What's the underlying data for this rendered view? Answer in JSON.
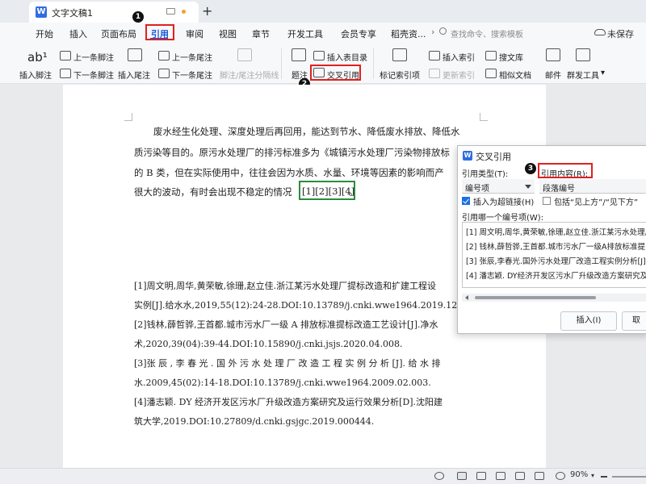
{
  "titlebar": {
    "doc_icon": "W",
    "doc_title": "文字文稿1",
    "add_tab": "+"
  },
  "left_glyph": "⟲",
  "menu": {
    "items": [
      "开始",
      "插入",
      "页面布局",
      "引用",
      "审阅",
      "视图",
      "章节",
      "开发工具",
      "会员专享",
      "稻壳资..."
    ],
    "active": "引用",
    "more": "›",
    "search_placeholder": "查找命令、搜索模板",
    "unsaved": "未保存"
  },
  "ribbon": {
    "insert_footnote": "插入脚注",
    "prev_footnote": "上一条脚注",
    "next_footnote": "下一条脚注",
    "insert_endnote": "插入尾注",
    "prev_endnote": "上一条尾注",
    "next_endnote": "下一条尾注",
    "footnote_separator": "脚注/尾注分隔线",
    "caption": "题注",
    "insert_toc": "插入表目录",
    "cross_reference": "交叉引用",
    "mark_index": "标记索引项",
    "insert_index": "插入索引",
    "update_index": "更新索引",
    "search_library": "搜文库",
    "similar_docs": "相似文档",
    "mail": "邮件",
    "mass_tools": "群发工具"
  },
  "steps": {
    "one": "1",
    "two": "2",
    "three": "3"
  },
  "document": {
    "paragraph_lines": [
      "废水经生化处理、深度处理后再回用，能达到节水、降低废水排放、降低水",
      "质污染等目的。原污水处理厂的排污标准多为《城镇污水处理厂污染物排放标",
      "的 B 类，但在实际使用中，往往会因为水质、水量、环境等因素的影响而产",
      "很大的波动，有时会出现不稳定的情况"
    ],
    "citation_marks": "[1][2][3][4]",
    "citation_tail": "。",
    "references": [
      "[1]周文明,周华,黄荣敏,徐珊,赵立佳.浙江某污水处理厂提标改造和扩建工程设",
      "实例[J].给水水,2019,55(12):24-28.DOI:10.13789/j.cnki.wwe1964.2019.12.00",
      "[2]钱林,薛哲骅,王首都.城市污水厂一级 A 排放标准提标改造工艺设计[J].净水",
      "术,2020,39(04):39-44.DOI:10.15890/j.cnki.jsjs.2020.04.008.",
      "[3]张 辰 , 李 春 光 . 国 外 污 水 处 理 厂 改 造 工 程 实 例 分 析 [J]. 给 水 排",
      "水.2009,45(02):14-18.DOI:10.13789/j.cnki.wwe1964.2009.02.003.",
      "[4]潘志颖. DY 经济开发区污水厂升级改造方案研究及运行效果分析[D].沈阳建",
      "筑大学,2019.DOI:10.27809/d.cnki.gsjgc.2019.000444."
    ]
  },
  "dialog": {
    "title_icon": "W",
    "title": "交叉引用",
    "ref_type_label": "引用类型(T):",
    "ref_type_value": "编号项",
    "ref_content_label": "引用内容(R):",
    "ref_content_value": "段落编号",
    "hyperlink_label": "插入为超链接(H)",
    "include_label": "包括“见上方”/“见下方”",
    "which_label": "引用哪一个编号项(W):",
    "items": [
      "[1] 周文明,周华,黄荣敏,徐珊,赵立佳.浙江某污水处理厂",
      "[2] 钱林,薛哲骅,王首都.城市污水厂一级A排放标准提",
      "[3] 张辰,李春光.国外污水处理厂改造工程实例分析[J]",
      "[4] 潘志颖. DY经济开发区污水厂升级改造方案研究及"
    ],
    "insert_button": "插入(I)",
    "close_button": "取"
  },
  "status": {
    "zoom": "90%"
  },
  "colors": {
    "accent": "#1a56d6",
    "highlight_red": "#e02020",
    "highlight_green": "#2e8b3e",
    "checkbox_blue": "#1a6fe0"
  }
}
